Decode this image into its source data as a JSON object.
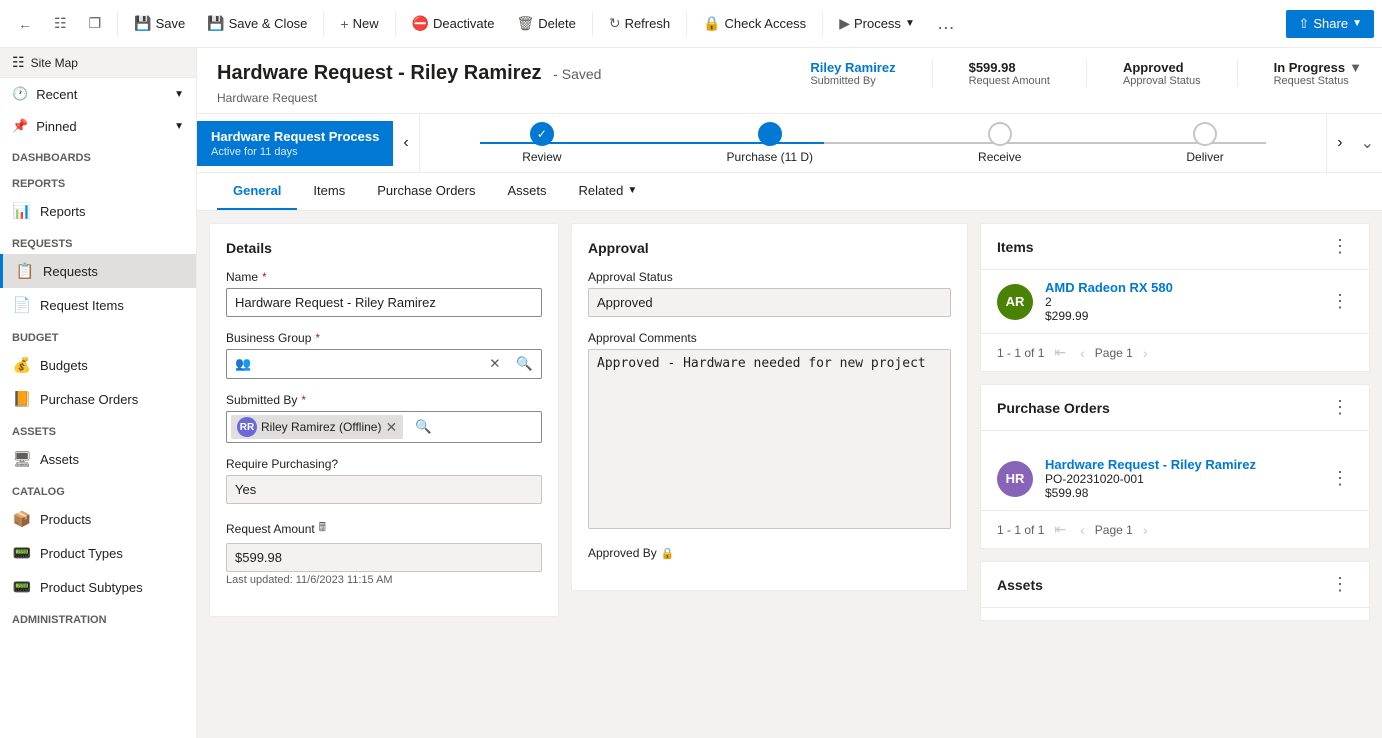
{
  "toolbar": {
    "save_label": "Save",
    "save_close_label": "Save & Close",
    "new_label": "New",
    "deactivate_label": "Deactivate",
    "delete_label": "Delete",
    "refresh_label": "Refresh",
    "check_access_label": "Check Access",
    "process_label": "Process",
    "share_label": "Share",
    "more_label": "..."
  },
  "record": {
    "title": "Hardware Request - Riley Ramirez",
    "saved_label": "- Saved",
    "subtitle": "Hardware Request",
    "submitted_by": "Riley Ramirez",
    "submitted_by_label": "Submitted By",
    "request_amount": "$599.98",
    "request_amount_label": "Request Amount",
    "approval_status": "Approved",
    "approval_status_label": "Approval Status",
    "request_status": "In Progress",
    "request_status_label": "Request Status"
  },
  "process": {
    "stage_name": "Hardware Request Process",
    "stage_sub": "Active for 11 days",
    "steps": [
      {
        "label": "Review",
        "state": "completed"
      },
      {
        "label": "Purchase  (11 D)",
        "state": "active"
      },
      {
        "label": "Receive",
        "state": "pending"
      },
      {
        "label": "Deliver",
        "state": "pending"
      }
    ]
  },
  "tabs": [
    {
      "label": "General",
      "active": true
    },
    {
      "label": "Items",
      "active": false
    },
    {
      "label": "Purchase Orders",
      "active": false
    },
    {
      "label": "Assets",
      "active": false
    },
    {
      "label": "Related",
      "active": false,
      "has_dropdown": true
    }
  ],
  "details_panel": {
    "title": "Details",
    "name_label": "Name",
    "name_value": "Hardware Request - Riley Ramirez",
    "business_group_label": "Business Group",
    "submitted_by_label": "Submitted By",
    "submitted_by_value": "Riley Ramirez (Offline)",
    "require_purchasing_label": "Require Purchasing?",
    "require_purchasing_value": "Yes",
    "request_amount_label": "Request Amount",
    "request_amount_value": "$599.98",
    "last_updated_label": "Last updated:",
    "last_updated_value": "11/6/2023 11:15 AM"
  },
  "approval_panel": {
    "title": "Approval",
    "status_label": "Approval Status",
    "status_value": "Approved",
    "comments_label": "Approval Comments",
    "comments_value": "Approved - Hardware needed for new project",
    "approved_by_label": "Approved By"
  },
  "items_panel": {
    "title": "Items",
    "items": [
      {
        "initials": "AR",
        "bg_color": "#498205",
        "name": "AMD Radeon RX 580",
        "quantity": "2",
        "price": "$299.99"
      }
    ],
    "pagination": "1 - 1 of 1",
    "page_label": "Page 1"
  },
  "purchase_orders_panel": {
    "title": "Purchase Orders",
    "items": [
      {
        "initials": "HR",
        "bg_color": "#8764b8",
        "name": "Hardware Request - Riley Ramirez",
        "po_number": "PO-20231020-001",
        "amount": "$599.98"
      }
    ],
    "pagination": "1 - 1 of 1",
    "page_label": "Page 1"
  },
  "assets_panel": {
    "title": "Assets"
  },
  "sidebar": {
    "site_map_label": "Site Map",
    "recent_label": "Recent",
    "pinned_label": "Pinned",
    "sections": [
      {
        "name": "Dashboards",
        "items": []
      },
      {
        "name": "Reports",
        "items": []
      },
      {
        "name": "Requests",
        "items": [
          {
            "label": "Requests",
            "active": true
          },
          {
            "label": "Request Items",
            "active": false
          }
        ]
      },
      {
        "name": "Budget",
        "items": [
          {
            "label": "Budgets",
            "active": false
          },
          {
            "label": "Purchase Orders",
            "active": false
          }
        ]
      },
      {
        "name": "Assets",
        "items": [
          {
            "label": "Assets",
            "active": false
          }
        ]
      },
      {
        "name": "Catalog",
        "items": [
          {
            "label": "Products",
            "active": false
          },
          {
            "label": "Product Types",
            "active": false
          },
          {
            "label": "Product Subtypes",
            "active": false
          }
        ]
      },
      {
        "name": "Administration",
        "items": []
      }
    ]
  }
}
